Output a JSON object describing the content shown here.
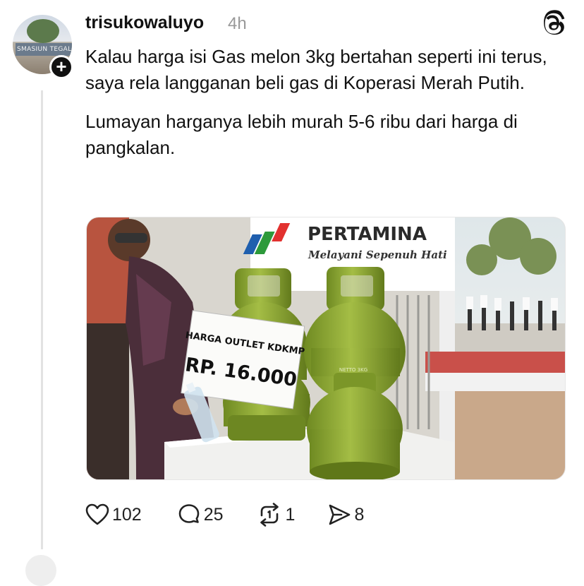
{
  "post": {
    "username": "trisukowaluyo",
    "time": "4h",
    "paragraphs": [
      "Kalau harga isi Gas melon 3kg bertahan seperti ini terus, saya rela langganan beli gas di Koperasi Merah Putih.",
      "Lumayan harganya lebih murah 5-6 ribu dari harga di pangkalan."
    ],
    "avatar_sign_text": "SMASIUN TEGAL",
    "image": {
      "banner_brand": "PERTAMINA",
      "banner_tagline": "Melayani Sepenuh Hati",
      "price_sign_line1": "HARGA OUTLET KDKMP",
      "price_sign_line2": "RP. 16.000"
    },
    "actions": {
      "likes": "102",
      "replies": "25",
      "reposts": "1",
      "shares": "8"
    }
  },
  "icons": {
    "follow": "plus-icon",
    "logo": "threads-logo-icon",
    "like": "heart-icon",
    "reply": "comment-icon",
    "repost": "repost-icon",
    "share": "share-icon"
  },
  "colors": {
    "text": "#111111",
    "muted": "#999999",
    "thread_line": "#e2e2e2",
    "cylinder_green": "#8aa332"
  }
}
